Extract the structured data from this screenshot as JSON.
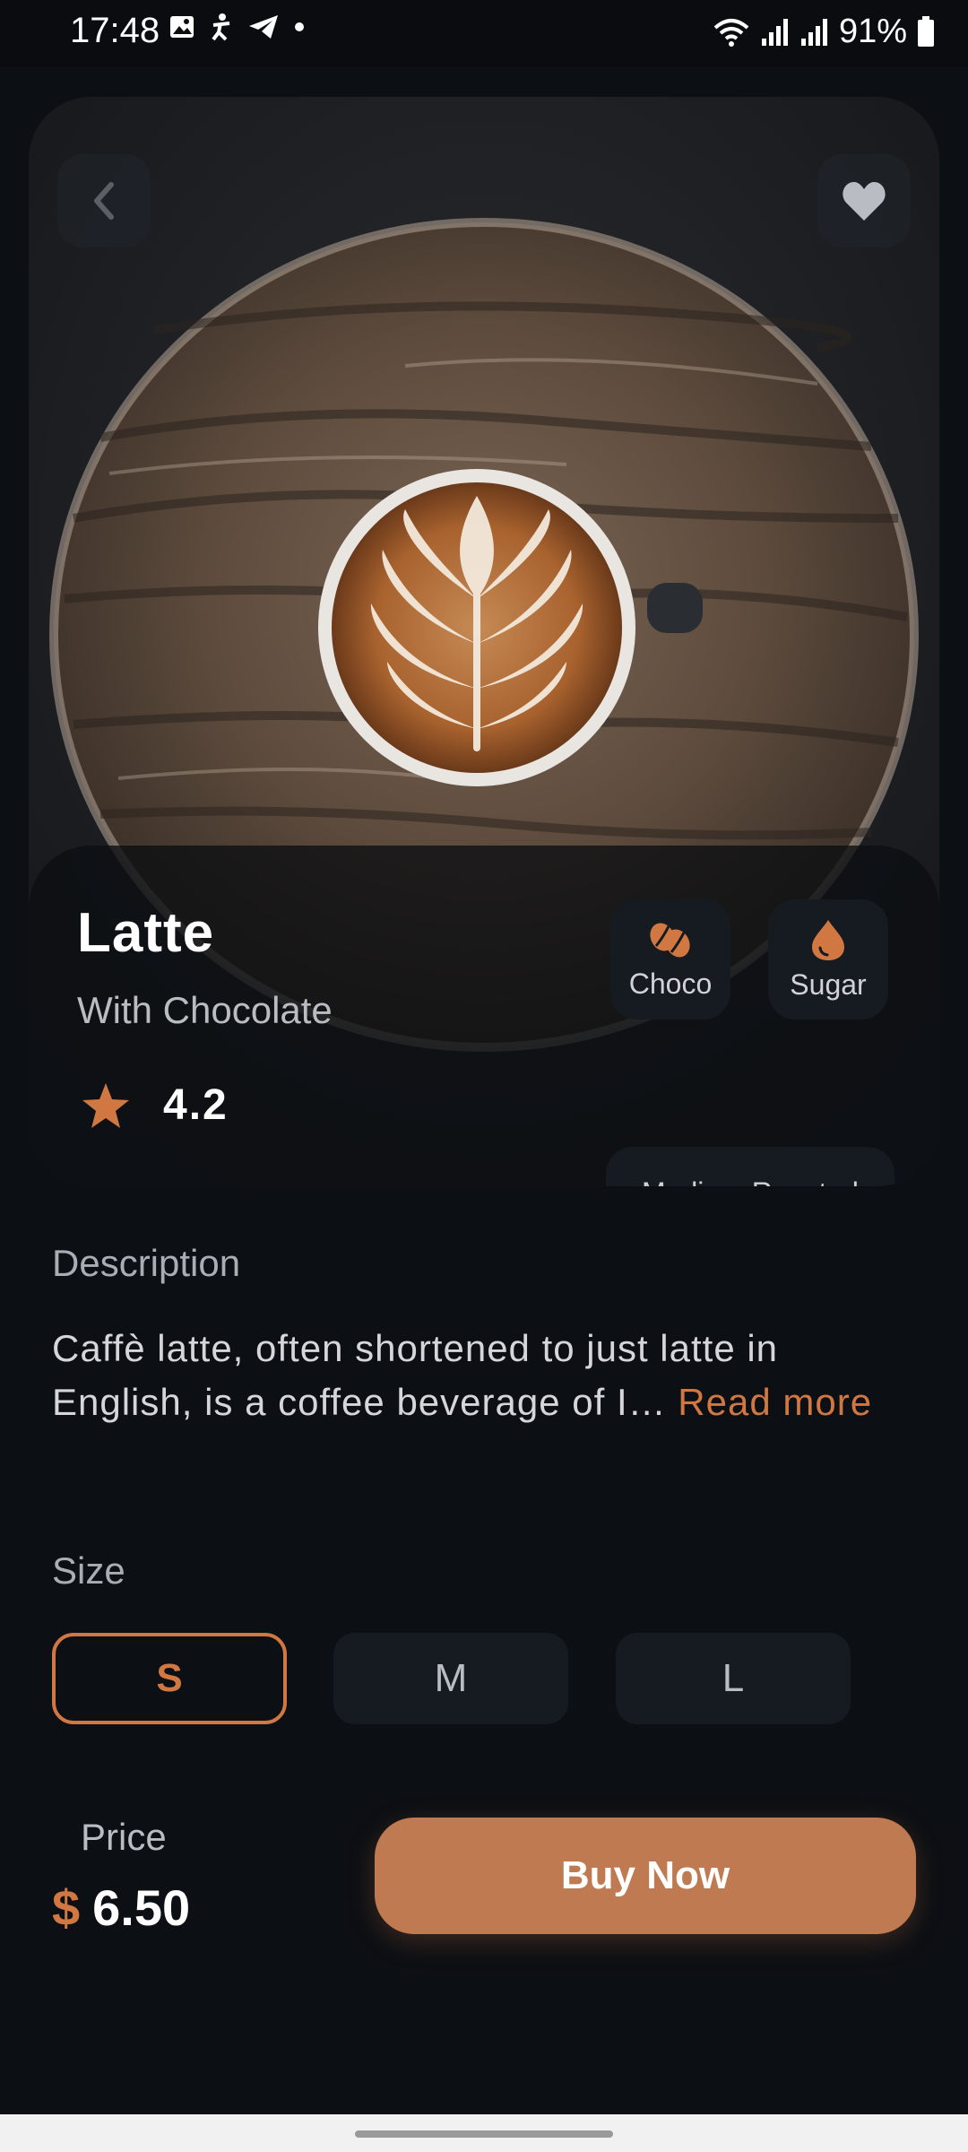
{
  "status_bar": {
    "time": "17:48",
    "battery": "91%",
    "icons": [
      "gallery-icon",
      "accessibility-icon",
      "telegram-icon",
      "dot-icon",
      "wifi-icon",
      "signal-icon",
      "signal-icon",
      "battery-icon"
    ]
  },
  "hero": {
    "back_icon": "chevron-left-icon",
    "favorite_icon": "heart-icon"
  },
  "product": {
    "name": "Latte",
    "subtitle": "With Chocolate",
    "rating": "4.2",
    "tags": [
      {
        "label": "Choco",
        "icon": "coffee-bean-icon"
      },
      {
        "label": "Sugar",
        "icon": "drop-icon"
      }
    ],
    "roast": "Medium Roasted"
  },
  "description": {
    "label": "Description",
    "text": "Caffè latte, often shortened to just latte in English, is a coffee beverage of I…",
    "read_more": "Read more"
  },
  "size": {
    "label": "Size",
    "options": [
      "S",
      "M",
      "L"
    ],
    "selected": "S"
  },
  "price": {
    "label": "Price",
    "currency": "$",
    "value": "6.50"
  },
  "buy_button": "Buy Now",
  "colors": {
    "accent": "#d17842",
    "background": "#0c0f14",
    "surface": "#161a21",
    "button": "#c07a52"
  }
}
